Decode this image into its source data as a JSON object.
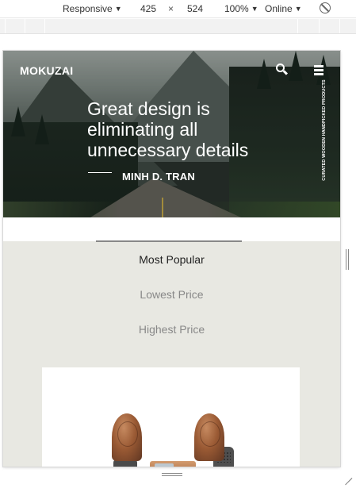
{
  "devtools": {
    "device": "Responsive",
    "width": "425",
    "times": "×",
    "height": "524",
    "zoom": "100%",
    "network": "Online",
    "caret": "▼"
  },
  "page": {
    "brand": "MOKUZAI",
    "quote": "Great design is eliminating all unnecessary details",
    "author": "MINH D. TRAN",
    "vertical_caption": "CURATED WOODEN HANDPICKED PRODUCTS",
    "sort_options": [
      "Most Popular",
      "Lowest Price",
      "Highest Price"
    ],
    "active_sort": "Most Popular"
  },
  "colors": {
    "page_bg": "#e8e8e2",
    "accent_indicator": "#888888",
    "hero_text": "#ffffff"
  },
  "icons": [
    "search-icon",
    "menu-icon",
    "rotate-disabled-icon",
    "resize-handle-icon"
  ]
}
